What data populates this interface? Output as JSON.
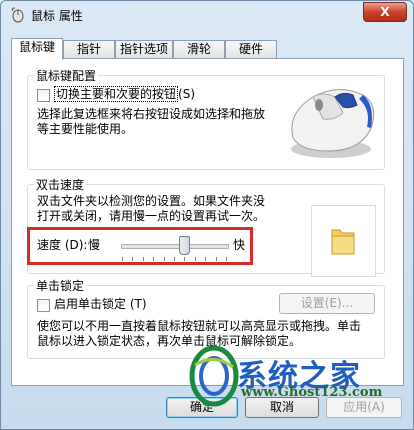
{
  "window": {
    "title": "鼠标 属性",
    "close_label": "X"
  },
  "tabs": [
    {
      "label": "鼠标键",
      "active": true
    },
    {
      "label": "指针",
      "active": false
    },
    {
      "label": "指针选项",
      "active": false
    },
    {
      "label": "滑轮",
      "active": false
    },
    {
      "label": "硬件",
      "active": false
    }
  ],
  "button_config": {
    "title": "鼠标键配置",
    "swap_checkbox_label": "切换主要和次要的按钮",
    "swap_checkbox_hotkey": "(S)",
    "swap_checked": false,
    "description_line1": "选择此复选框来将右按钮设成如选择和拖放",
    "description_line2": "等主要性能使用。"
  },
  "double_click": {
    "title": "双击速度",
    "description_line1": "双击文件夹以检测您的设置。如果文件夹没",
    "description_line2": "打开或关闭，请用慢一点的设置再试一次。",
    "speed_label": "速度 (D):",
    "slow_label": "慢",
    "fast_label": "快",
    "speed_value": 0.6,
    "tick_count": 11
  },
  "click_lock": {
    "title": "单击锁定",
    "checkbox_label": "启用单击锁定 (T)",
    "checked": false,
    "settings_button": "设置(E)...",
    "description_line1": "使您可以不用一直按着鼠标按钮就可以高亮显示或拖拽。单击",
    "description_line2": "鼠标以进入锁定状态，再次单击鼠标可解除锁定。"
  },
  "footer": {
    "ok_button": "确定",
    "cancel_button": "取消",
    "apply_button": "应用(A)"
  },
  "watermark": {
    "text_main": "系统之家",
    "text_url": "www.Ghost123.com"
  }
}
